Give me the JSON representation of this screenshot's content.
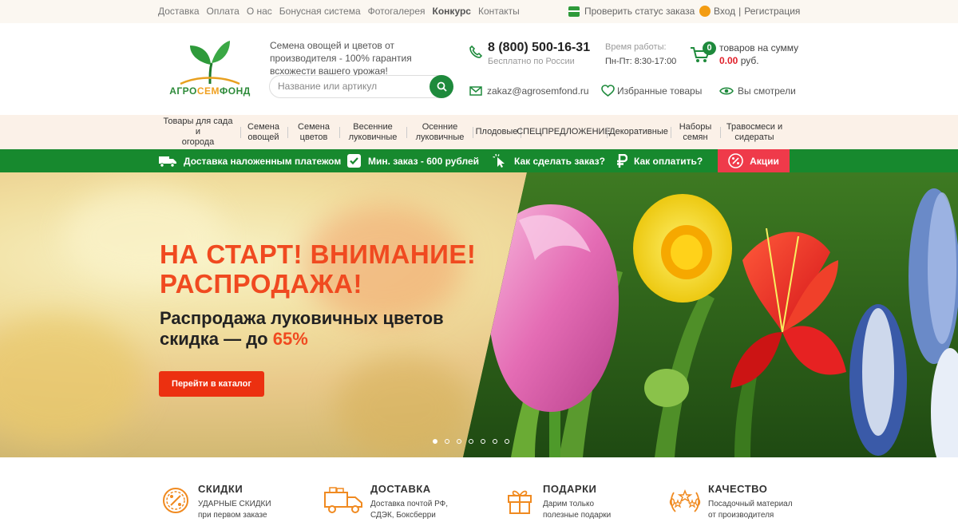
{
  "topnav": {
    "links": [
      "Доставка",
      "Оплата",
      "О нас",
      "Бонусная система",
      "Фотогалерея",
      "Конкурс",
      "Контакты"
    ],
    "check_status": "Проверить статус заказа",
    "login": "Вход",
    "separator": "|",
    "register": "Регистрация"
  },
  "header": {
    "logo_left": "АГРО",
    "logo_mid": "СЕМ",
    "logo_right": "ФОНД",
    "tagline": "Семена овощей и цветов от производителя - 100% гарантия всхожести вашего урожая!",
    "search_placeholder": "Название или артикул",
    "phone": "8 (800) 500-16-31",
    "phone_sub": "Бесплатно по России",
    "hours_label": "Время работы:",
    "hours": "Пн-Пт: 8:30-17:00",
    "cart_count": "0",
    "cart_text": "товаров на сумму",
    "cart_sum": "0.00",
    "cart_currency": "руб.",
    "email": "zakaz@agrosemfond.ru",
    "favorites": "Избранные товары",
    "viewed": "Вы смотрели"
  },
  "categories": [
    {
      "line1": "Товары для сада и",
      "line2": "огорода"
    },
    {
      "line1": "Семена",
      "line2": "овощей"
    },
    {
      "line1": "Семена",
      "line2": "цветов"
    },
    {
      "line1": "Весенние",
      "line2": "луковичные"
    },
    {
      "line1": "Осенние",
      "line2": "луковичные"
    },
    {
      "line1": "Плодовые",
      "line2": ""
    },
    {
      "line1": "СПЕЦПРЕДЛОЖЕНИЕ",
      "line2": ""
    },
    {
      "line1": "Декоративные",
      "line2": ""
    },
    {
      "line1": "Наборы",
      "line2": "семян"
    },
    {
      "line1": "Травосмеси и",
      "line2": "сидераты"
    }
  ],
  "greenbar": {
    "delivery": "Доставка наложенным платежом",
    "min_order": "Мин. заказ - 600 рублей",
    "how_order": "Как сделать заказ?",
    "how_pay": "Как оплатить?",
    "promo": "Акции"
  },
  "hero": {
    "title_line1": "НА СТАРТ! ВНИМАНИЕ!",
    "title_line2": "РАСПРОДАЖА!",
    "subtitle_line1": "Распродажа луковичных цветов",
    "subtitle_line2": "скидка — до",
    "subtitle_pct": "65%",
    "button": "Перейти в каталог",
    "slides_total": 7,
    "active_slide": 1
  },
  "features": [
    {
      "title": "СКИДКИ",
      "line1": "УДАРНЫЕ СКИДКИ",
      "line2": "при первом заказе",
      "icon": "percent-badge-icon"
    },
    {
      "title": "ДОСТАВКА",
      "line1": "Доставка почтой РФ,",
      "line2": "СДЭК, Боксберри",
      "icon": "delivery-truck-icon"
    },
    {
      "title": "ПОДАРКИ",
      "line1": "Дарим только",
      "line2": "полезные подарки",
      "icon": "gift-box-icon"
    },
    {
      "title": "КАЧЕСТВО",
      "line1": "Посадочный материал",
      "line2": "от производителя",
      "icon": "laurel-stars-icon"
    }
  ],
  "colors": {
    "brand_green": "#17892e",
    "accent_red": "#ef3a4a",
    "hero_orange": "#f04a20",
    "feature_orange": "#f08a20"
  }
}
